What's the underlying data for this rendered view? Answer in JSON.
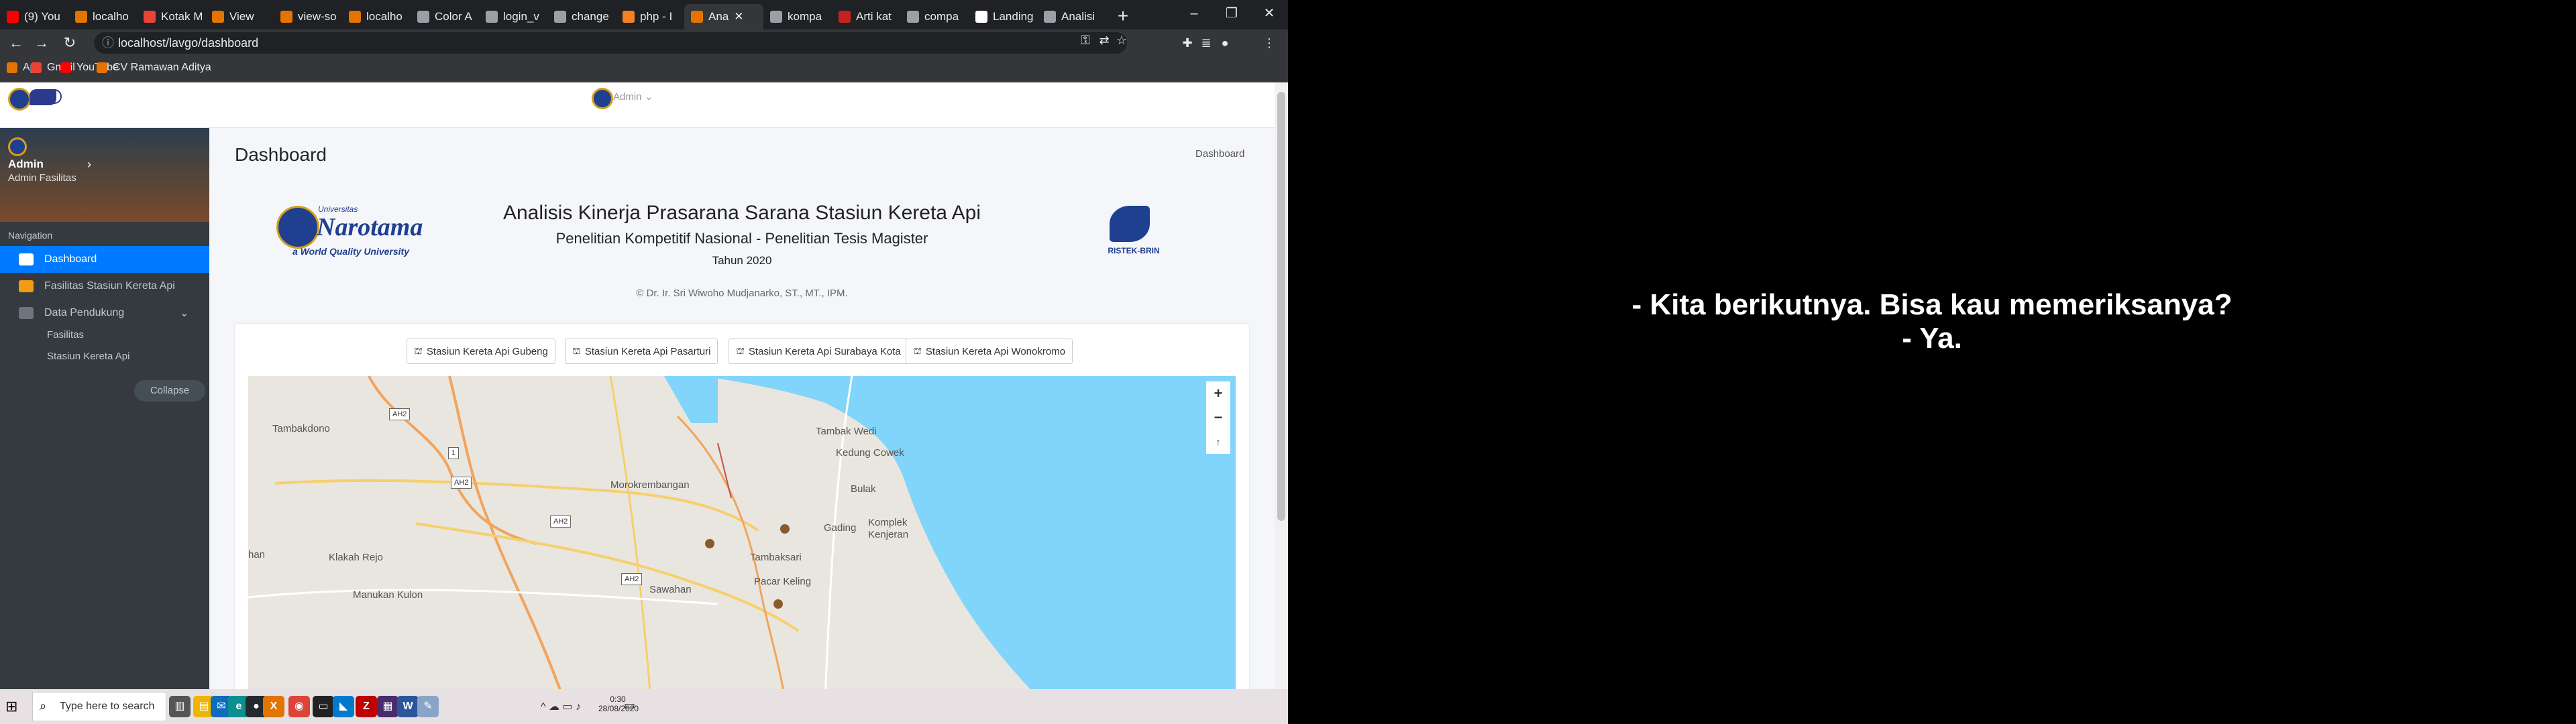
{
  "browser": {
    "tabs": [
      {
        "label": "(9) You",
        "color": "#ff0000"
      },
      {
        "label": "localho",
        "color": "#e37400"
      },
      {
        "label": "Kotak M",
        "color": "#ea4335"
      },
      {
        "label": "View",
        "color": "#e37400"
      },
      {
        "label": "view-so",
        "color": "#e37400"
      },
      {
        "label": "localho",
        "color": "#e37400"
      },
      {
        "label": "Color A",
        "color": "#9aa0a6"
      },
      {
        "label": "login_v",
        "color": "#9aa0a6"
      },
      {
        "label": "change",
        "color": "#9aa0a6"
      },
      {
        "label": "php - I",
        "color": "#f48024"
      },
      {
        "label": "Ana",
        "color": "#e37400"
      },
      {
        "label": "kompa",
        "color": "#9aa0a6"
      },
      {
        "label": "Arti kat",
        "color": "#c5221f"
      },
      {
        "label": "compa",
        "color": "#9aa0a6"
      },
      {
        "label": "Landing",
        "color": "#ffffff"
      },
      {
        "label": "Analisi",
        "color": "#9aa0a6"
      }
    ],
    "new_tab": "+",
    "url": "localhost/lavgo/dashboard",
    "bookmarks": [
      {
        "label": "Apl",
        "color": "#e37400"
      },
      {
        "label": "Gmail",
        "color": "#ea4335"
      },
      {
        "label": "YouTube",
        "color": "#ff0000"
      },
      {
        "label": "CV Ramawan Aditya",
        "color": "#e37400"
      }
    ]
  },
  "topnav": {
    "user_label": "Admin"
  },
  "sidebar": {
    "user_name": "Admin",
    "user_role": "Admin Fasilitas",
    "nav_header": "Navigation",
    "items": [
      {
        "label": "Dashboard",
        "icon": "monitor-icon"
      },
      {
        "label": "Fasilitas Stasiun Kereta Api",
        "icon": "facility-icon"
      },
      {
        "label": "Data Pendukung",
        "icon": "database-icon"
      }
    ],
    "sub_items": [
      "Fasilitas",
      "Stasiun Kereta Api"
    ],
    "collapse_label": "Collapse"
  },
  "content": {
    "page_title": "Dashboard",
    "breadcrumb": "Dashboard",
    "hero": {
      "title": "Analisis Kinerja Prasarana Sarana Stasiun Kereta Api",
      "subtitle": "Penelitian Kompetitif Nasional - Penelitian Tesis Magister",
      "year": "Tahun 2020",
      "copyright": "© Dr. Ir. Sri Wiwoho Mudjanarko, ST., MT., IPM.",
      "university_logo_text": "Universitas",
      "university_name": "Narotama",
      "university_tagline": "a World Quality University",
      "partner_logo_text": "RISTEK-BRIN"
    },
    "station_buttons": [
      "Stasiun Kereta Api Gubeng",
      "Stasiun Kereta Api Pasarturi",
      "Stasiun Kereta Api Surabaya Kota",
      "Stasiun Kereta Api Wonokromo"
    ],
    "map": {
      "places": [
        "Tambakdono",
        "Tambak Wedi",
        "Kedung Cowek",
        "Bulak",
        "Morokrembangan",
        "Gading",
        "Komplek",
        "Kenjeran",
        "han",
        "Klakah Rejo",
        "Tambaksari",
        "Sawahan",
        "Pacar Keling",
        "Manukan Kulon"
      ],
      "road_labels": [
        "AH2",
        "1",
        "AH2",
        "AH2",
        "AH2"
      ],
      "zoom_in": "+",
      "zoom_out": "−",
      "reset": "↑"
    }
  },
  "taskbar": {
    "search_placeholder": "Type here to search",
    "time": "0:30",
    "date": "28/08/2020"
  },
  "subtitles": {
    "line1": "- Kita berikutnya. Bisa kau memeriksanya?",
    "line2": "- Ya."
  }
}
